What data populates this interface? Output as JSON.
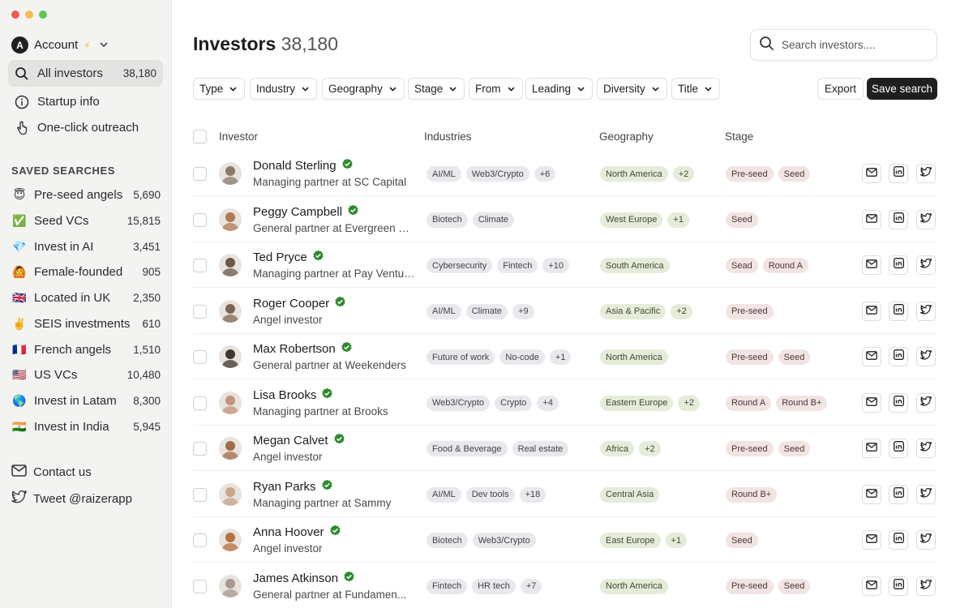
{
  "window": {
    "controls": [
      "#ee5a52",
      "#f5bd4f",
      "#5fc454"
    ]
  },
  "account": {
    "avatar_letter": "A",
    "label": "Account",
    "bolt": "⚡"
  },
  "nav": {
    "all_investors": {
      "label": "All investors",
      "count": "38,180"
    },
    "startup_info": {
      "label": "Startup info"
    },
    "outreach": {
      "label": "One-click outreach"
    }
  },
  "saved": {
    "title": "SAVED SEARCHES",
    "items": [
      {
        "emoji": "😇",
        "label": "Pre-seed angels",
        "count": "5,690"
      },
      {
        "emoji": "✅",
        "label": "Seed VCs",
        "count": "15,815"
      },
      {
        "emoji": "💎",
        "label": "Invest in AI",
        "count": "3,451"
      },
      {
        "emoji": "🙆",
        "label": "Female-founded",
        "count": "905"
      },
      {
        "emoji": "🇬🇧",
        "label": "Located in UK",
        "count": "2,350"
      },
      {
        "emoji": "✌️",
        "label": "SEIS investments",
        "count": "610"
      },
      {
        "emoji": "🇫🇷",
        "label": "French angels",
        "count": "1,510"
      },
      {
        "emoji": "🇺🇸",
        "label": "US VCs",
        "count": "10,480"
      },
      {
        "emoji": "🌎",
        "label": "Invest in Latam",
        "count": "8,300"
      },
      {
        "emoji": "🇮🇳",
        "label": "Invest in India",
        "count": "5,945"
      }
    ]
  },
  "footer": {
    "contact": "Contact us",
    "tweet": "Tweet @raizerapp"
  },
  "header": {
    "title": "Investors",
    "count": "38,180"
  },
  "search": {
    "placeholder": "Search investors...."
  },
  "filters": [
    "Type",
    "Industry",
    "Geography",
    "Stage",
    "From",
    "Leading",
    "Diversity",
    "Title"
  ],
  "actions": {
    "export": "Export",
    "save": "Save search"
  },
  "columns": {
    "investor": "Investor",
    "industries": "Industries",
    "geography": "Geography",
    "stage": "Stage"
  },
  "rows": [
    {
      "name": "Donald Sterling",
      "role": "Managing partner at SC Capital",
      "industries": [
        "AI/ML",
        "Web3/Crypto",
        "+6"
      ],
      "geography": [
        "North America",
        "+2"
      ],
      "stage": [
        "Pre-seed",
        "Seed"
      ],
      "photo": "#8a7a6a"
    },
    {
      "name": "Peggy Campbell",
      "role": "General partner at Evergreen C...",
      "industries": [
        "Biotech",
        "Climate"
      ],
      "geography": [
        "West Europe",
        "+1"
      ],
      "stage": [
        "Seed"
      ],
      "photo": "#b07a55"
    },
    {
      "name": "Ted Pryce",
      "role": "Managing partner at Pay Ventures",
      "industries": [
        "Cybersecurity",
        "Fintech",
        "+10"
      ],
      "geography": [
        "South America"
      ],
      "stage": [
        "Sead",
        "Round A"
      ],
      "photo": "#6b5a4a"
    },
    {
      "name": "Roger Cooper",
      "role": "Angel investor",
      "industries": [
        "AI/ML",
        "Climate",
        "+9"
      ],
      "geography": [
        "Asia & Pacific",
        "+2"
      ],
      "stage": [
        "Pre-seed"
      ],
      "photo": "#7d6552"
    },
    {
      "name": "Max Robertson",
      "role": "General partner at Weekenders",
      "industries": [
        "Future of work",
        "No-code",
        "+1"
      ],
      "geography": [
        "North America"
      ],
      "stage": [
        "Pre-seed",
        "Seed"
      ],
      "photo": "#3e3530"
    },
    {
      "name": "Lisa Brooks",
      "role": "Managing partner at Brooks",
      "industries": [
        "Web3/Crypto",
        "Crypto",
        "+4"
      ],
      "geography": [
        "Eastern Europe",
        "+2"
      ],
      "stage": [
        "Round A",
        "Round B+"
      ],
      "photo": "#c4957a"
    },
    {
      "name": "Megan Calvet",
      "role": "Angel investor",
      "industries": [
        "Food & Beverage",
        "Real estate"
      ],
      "geography": [
        "Africa",
        "+2"
      ],
      "stage": [
        "Pre-seed",
        "Seed"
      ],
      "photo": "#a06b4a"
    },
    {
      "name": "Ryan Parks",
      "role": "Managing partner at Sammy",
      "industries": [
        "AI/ML",
        "Dev tools",
        "+18"
      ],
      "geography": [
        "Central Asia"
      ],
      "stage": [
        "Round B+"
      ],
      "photo": "#c9a48a"
    },
    {
      "name": "Anna Hoover",
      "role": "Angel investor",
      "industries": [
        "Biotech",
        "Web3/Crypto"
      ],
      "geography": [
        "East Europe",
        "+1"
      ],
      "stage": [
        "Seed"
      ],
      "photo": "#b8703f"
    },
    {
      "name": "James Atkinson",
      "role": "General partner at Fundamen...",
      "industries": [
        "Fintech",
        "HR tech",
        "+7"
      ],
      "geography": [
        "North America"
      ],
      "stage": [
        "Pre-seed",
        "Seed"
      ],
      "photo": "#a89890"
    }
  ]
}
